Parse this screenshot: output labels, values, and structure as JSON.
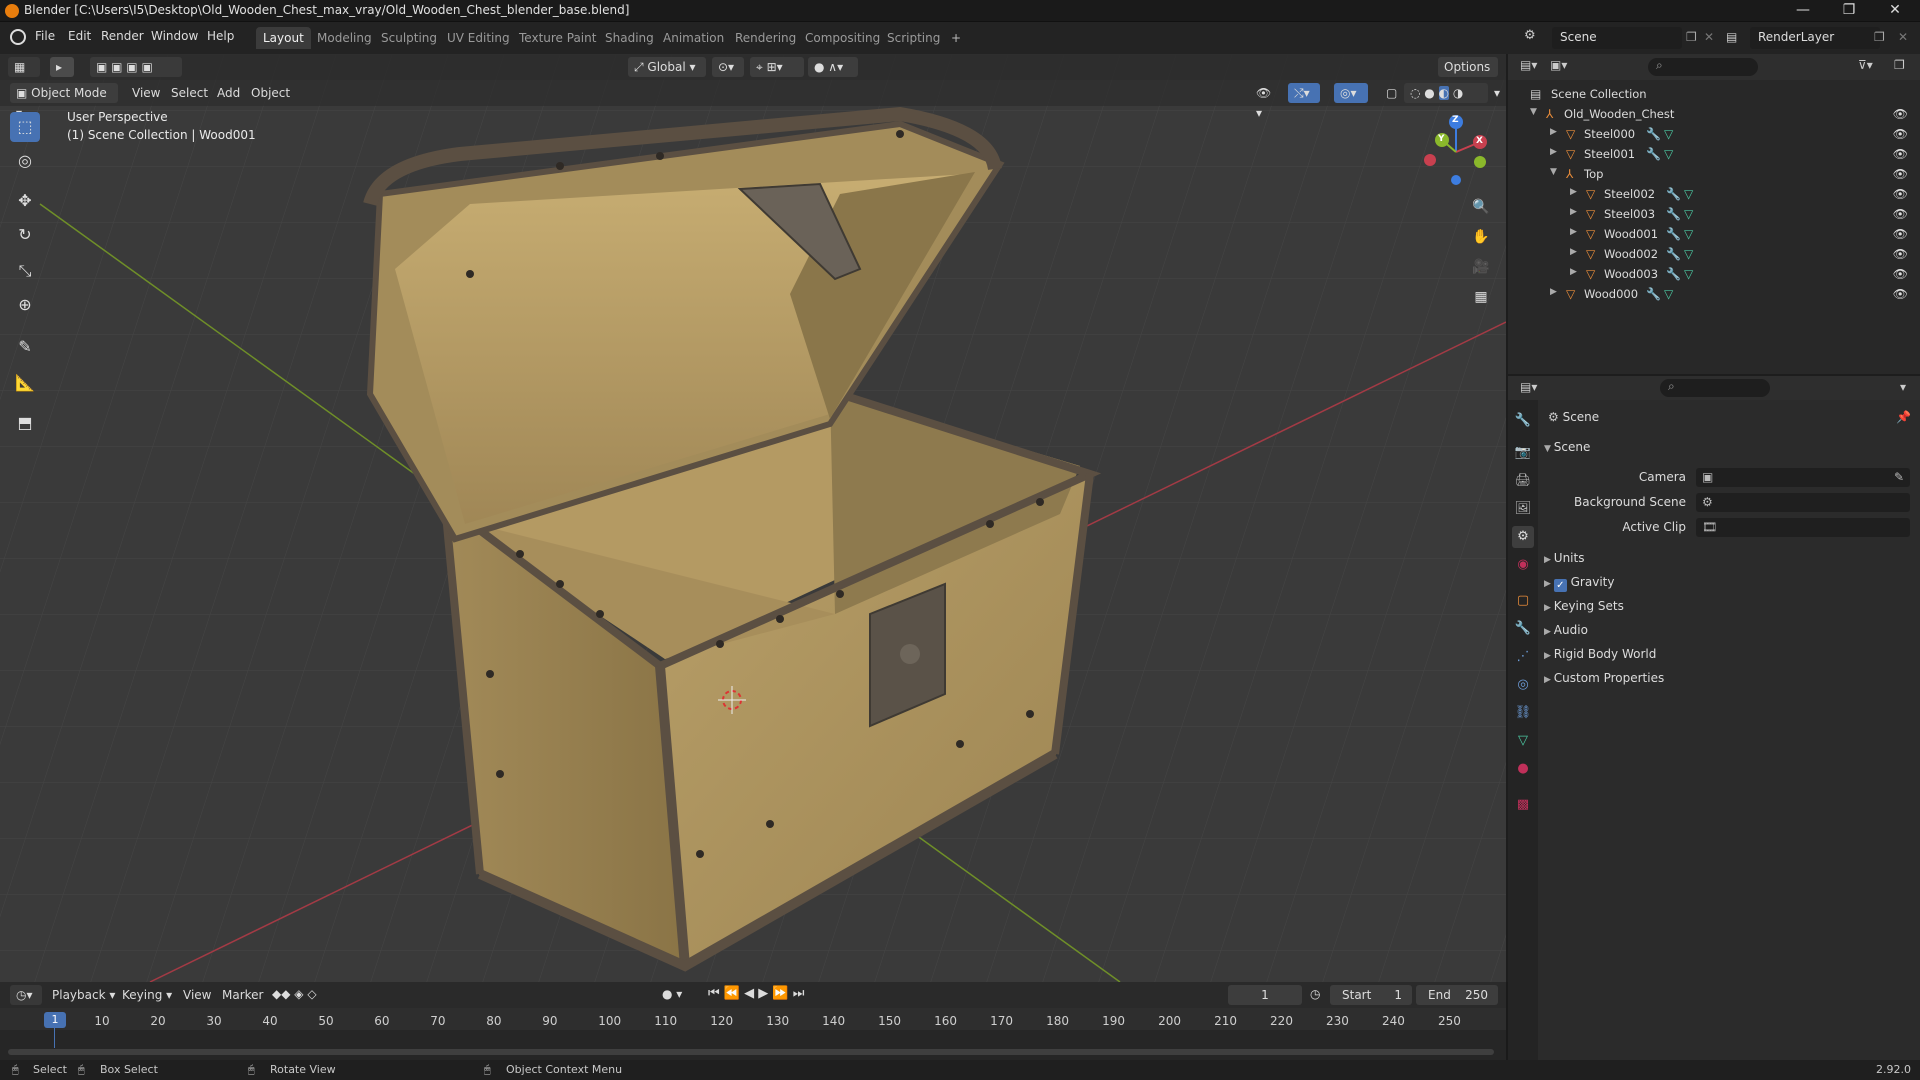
{
  "window": {
    "title": "Blender [C:\\Users\\I5\\Desktop\\Old_Wooden_Chest_max_vray/Old_Wooden_Chest_blender_base.blend]",
    "controls": [
      "—",
      "❐",
      "✕"
    ]
  },
  "menu": [
    "File",
    "Edit",
    "Render",
    "Window",
    "Help"
  ],
  "workspaces": [
    "Layout",
    "Modeling",
    "Sculpting",
    "UV Editing",
    "Texture Paint",
    "Shading",
    "Animation",
    "Rendering",
    "Compositing",
    "Scripting"
  ],
  "active_workspace": "Layout",
  "header_top": {
    "transform_orientation": "Global",
    "options_label": "Options",
    "scene_name": "Scene",
    "view_layer": "RenderLayer"
  },
  "viewport_header": {
    "mode": "Object Mode",
    "menus": [
      "View",
      "Select",
      "Add",
      "Object"
    ]
  },
  "viewport_overlay": {
    "line1": "User Perspective",
    "line2": "(1) Scene Collection | Wood001"
  },
  "gizmo": {
    "x_label": "X",
    "y_label": "Y",
    "z_label": "Z"
  },
  "outliner": {
    "root": "Scene Collection",
    "items": [
      {
        "name": "Old_Wooden_Chest",
        "depth": 0,
        "type": "empty",
        "expanded": true
      },
      {
        "name": "Steel000",
        "depth": 1,
        "type": "mesh",
        "expanded": false
      },
      {
        "name": "Steel001",
        "depth": 1,
        "type": "mesh",
        "expanded": false
      },
      {
        "name": "Top",
        "depth": 1,
        "type": "empty",
        "expanded": true
      },
      {
        "name": "Steel002",
        "depth": 2,
        "type": "mesh",
        "expanded": false
      },
      {
        "name": "Steel003",
        "depth": 2,
        "type": "mesh",
        "expanded": false
      },
      {
        "name": "Wood001",
        "depth": 2,
        "type": "mesh",
        "expanded": false
      },
      {
        "name": "Wood002",
        "depth": 2,
        "type": "mesh",
        "expanded": false
      },
      {
        "name": "Wood003",
        "depth": 2,
        "type": "mesh",
        "expanded": false
      },
      {
        "name": "Wood000",
        "depth": 1,
        "type": "mesh",
        "expanded": false
      }
    ]
  },
  "properties": {
    "breadcrumb": "Scene",
    "section_title": "Scene",
    "fields": [
      {
        "label": "Camera",
        "value": ""
      },
      {
        "label": "Background Scene",
        "value": ""
      },
      {
        "label": "Active Clip",
        "value": ""
      }
    ],
    "subsections": [
      "Units",
      "Gravity",
      "Keying Sets",
      "Audio",
      "Rigid Body World",
      "Custom Properties"
    ],
    "gravity_checked": true
  },
  "timeline": {
    "menus": [
      "Playback",
      "Keying",
      "View",
      "Marker"
    ],
    "current_frame": "1",
    "start_label": "Start",
    "start_value": "1",
    "end_label": "End",
    "end_value": "250",
    "ticks": [
      "1",
      "10",
      "20",
      "30",
      "40",
      "50",
      "60",
      "70",
      "80",
      "90",
      "100",
      "110",
      "120",
      "130",
      "140",
      "150",
      "160",
      "170",
      "180",
      "190",
      "200",
      "210",
      "220",
      "230",
      "240",
      "250"
    ]
  },
  "statusbar": {
    "select": "Select",
    "box_select": "Box Select",
    "rotate_view": "Rotate View",
    "context_menu": "Object Context Menu",
    "version": "2.92.0"
  },
  "colors": {
    "accent": "#4772b3",
    "x_axis": "#c8404f",
    "y_axis": "#8ab82b",
    "z_axis": "#3d7de0",
    "object_orange": "#e88c3a",
    "mesh_green": "#4cc7a1"
  }
}
